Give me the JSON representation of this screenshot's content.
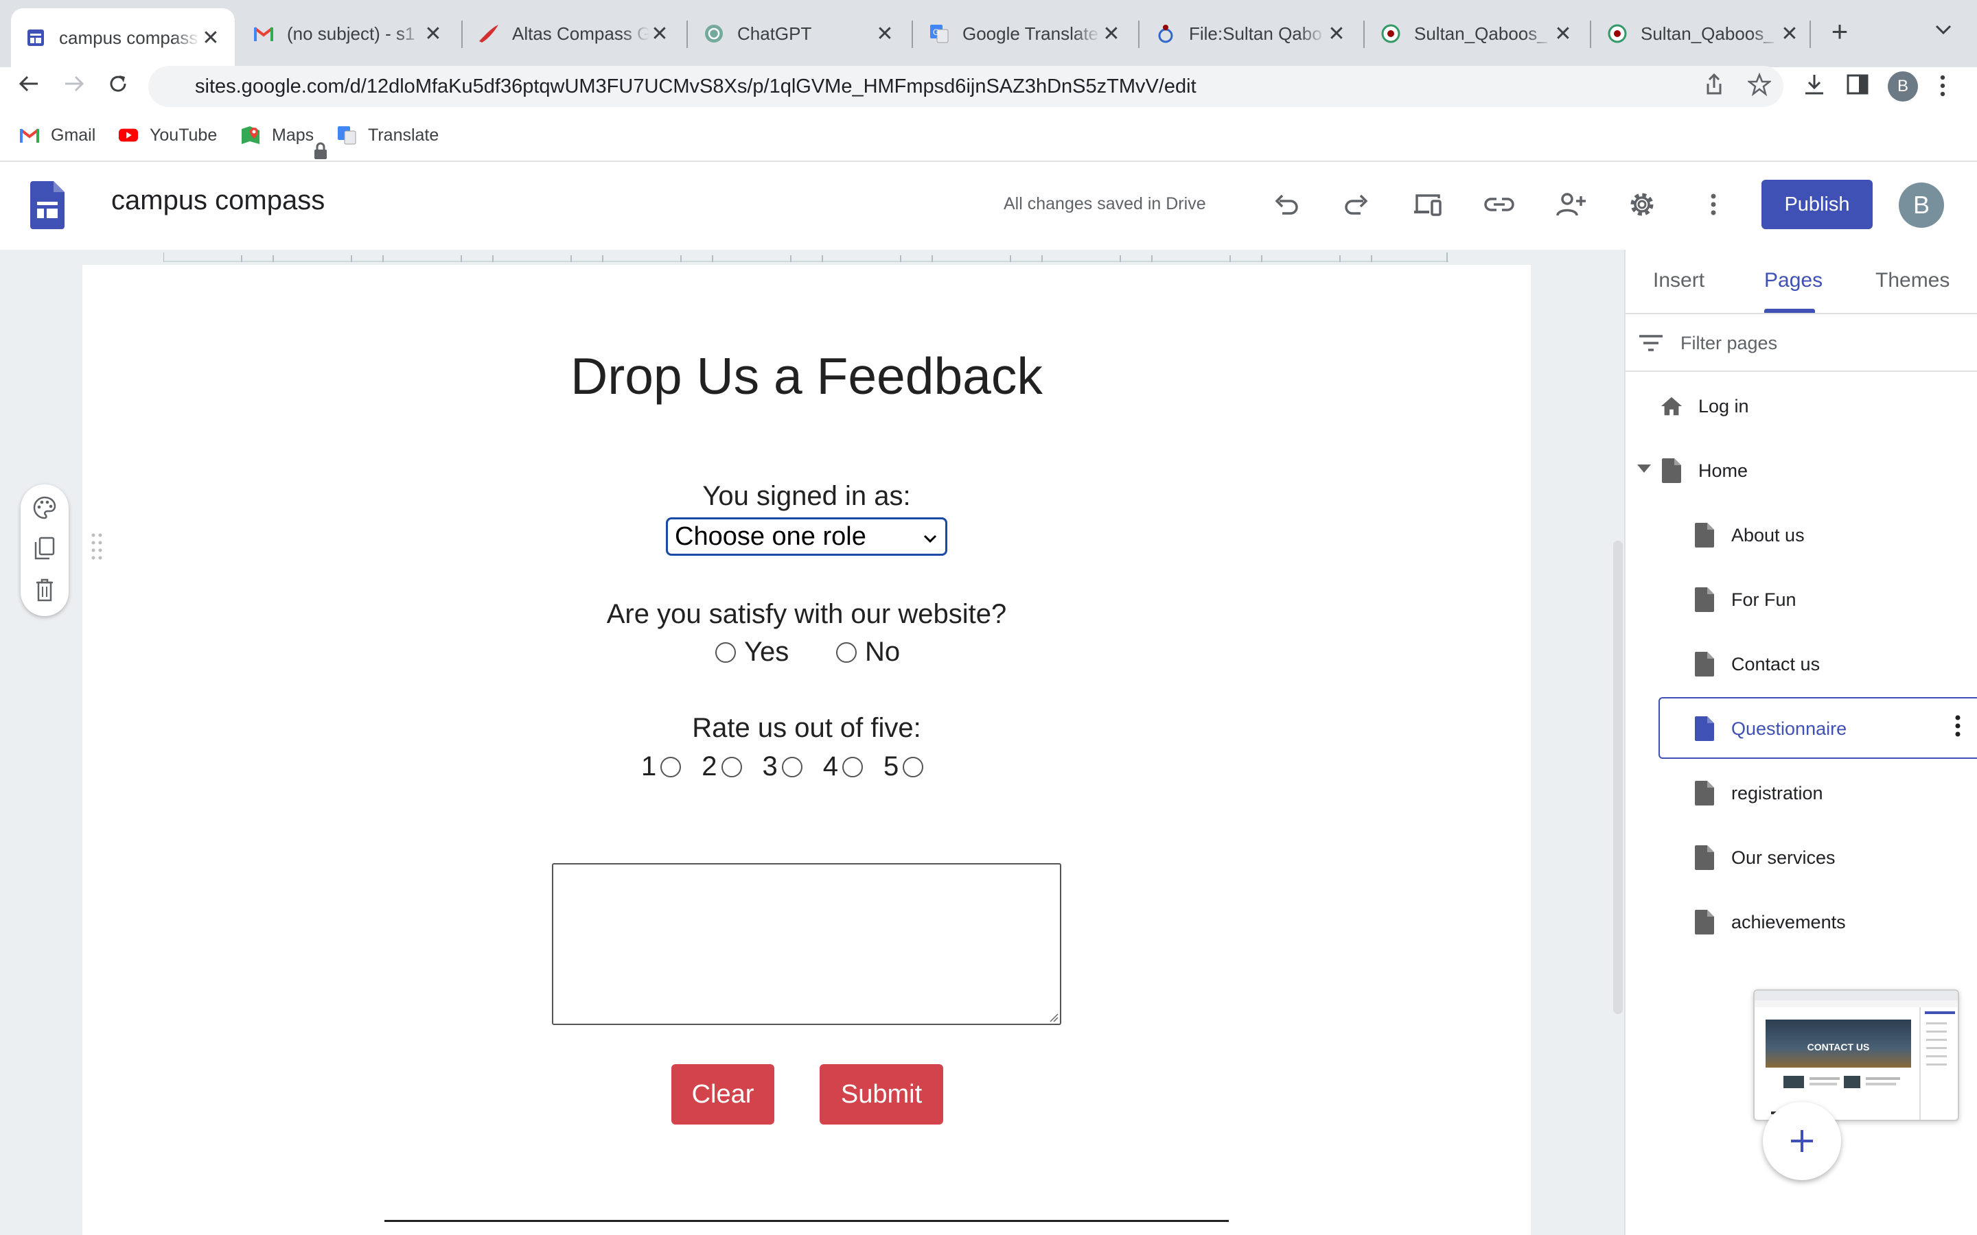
{
  "browser": {
    "tabs": [
      {
        "label": "campus compass",
        "icon": "google-sites-icon",
        "active": true
      },
      {
        "label": "(no subject) - s1",
        "icon": "gmail-icon"
      },
      {
        "label": "Altas Compass G",
        "icon": "altas-icon"
      },
      {
        "label": "ChatGPT",
        "icon": "chatgpt-icon"
      },
      {
        "label": "Google Translate",
        "icon": "translate-icon"
      },
      {
        "label": "File:Sultan Qabo",
        "icon": "wikimedia-icon"
      },
      {
        "label": "Sultan_Qaboos_",
        "icon": "wikipedia-icon"
      },
      {
        "label": "Sultan_Qaboos_",
        "icon": "wikipedia-icon"
      }
    ],
    "url": "sites.google.com/d/12dloMfaKu5df36ptqwUM3FU7UCMvS8Xs/p/1qlGVMe_HMFmpsd6ijnSAZ3hDnS5zTMvV/edit",
    "profile_initial": "B",
    "bookmarks": [
      {
        "label": "Gmail",
        "icon": "gmail-icon"
      },
      {
        "label": "YouTube",
        "icon": "youtube-icon"
      },
      {
        "label": "Maps",
        "icon": "maps-icon"
      },
      {
        "label": "Translate",
        "icon": "translate-icon"
      }
    ]
  },
  "editor": {
    "site_title": "campus compass",
    "save_status": "All changes saved in Drive",
    "publish_label": "Publish",
    "user_initial": "B"
  },
  "page": {
    "title": "Drop Us a Feedback",
    "signed_in_label": "You signed in as:",
    "role_select_value": "Choose one role",
    "satisfy_question": "Are you satisfy with our website?",
    "yes_label": "Yes",
    "no_label": "No",
    "rate_label": "Rate us out of five:",
    "rating_options": [
      "1",
      "2",
      "3",
      "4",
      "5"
    ],
    "clear_label": "Clear",
    "submit_label": "Submit"
  },
  "panel": {
    "tabs": [
      "Insert",
      "Pages",
      "Themes"
    ],
    "active_tab": "Pages",
    "filter_placeholder": "Filter pages",
    "pages": [
      {
        "label": "Log in",
        "icon": "home-icon"
      },
      {
        "label": "Home",
        "icon": "page-icon",
        "expanded": true
      },
      {
        "label": "About us",
        "icon": "page-icon"
      },
      {
        "label": "For Fun",
        "icon": "page-icon"
      },
      {
        "label": "Contact us",
        "icon": "page-icon"
      },
      {
        "label": "Questionnaire",
        "icon": "page-icon",
        "selected": true
      },
      {
        "label": "registration",
        "icon": "page-icon"
      },
      {
        "label": "Our services",
        "icon": "page-icon"
      },
      {
        "label": "achievements",
        "icon": "page-icon"
      }
    ],
    "thumbnail_text": "CONTACT US"
  },
  "colors": {
    "accent": "#3f51b5",
    "button_red": "#d3434b",
    "tabbar_bg": "#dee1e6"
  }
}
